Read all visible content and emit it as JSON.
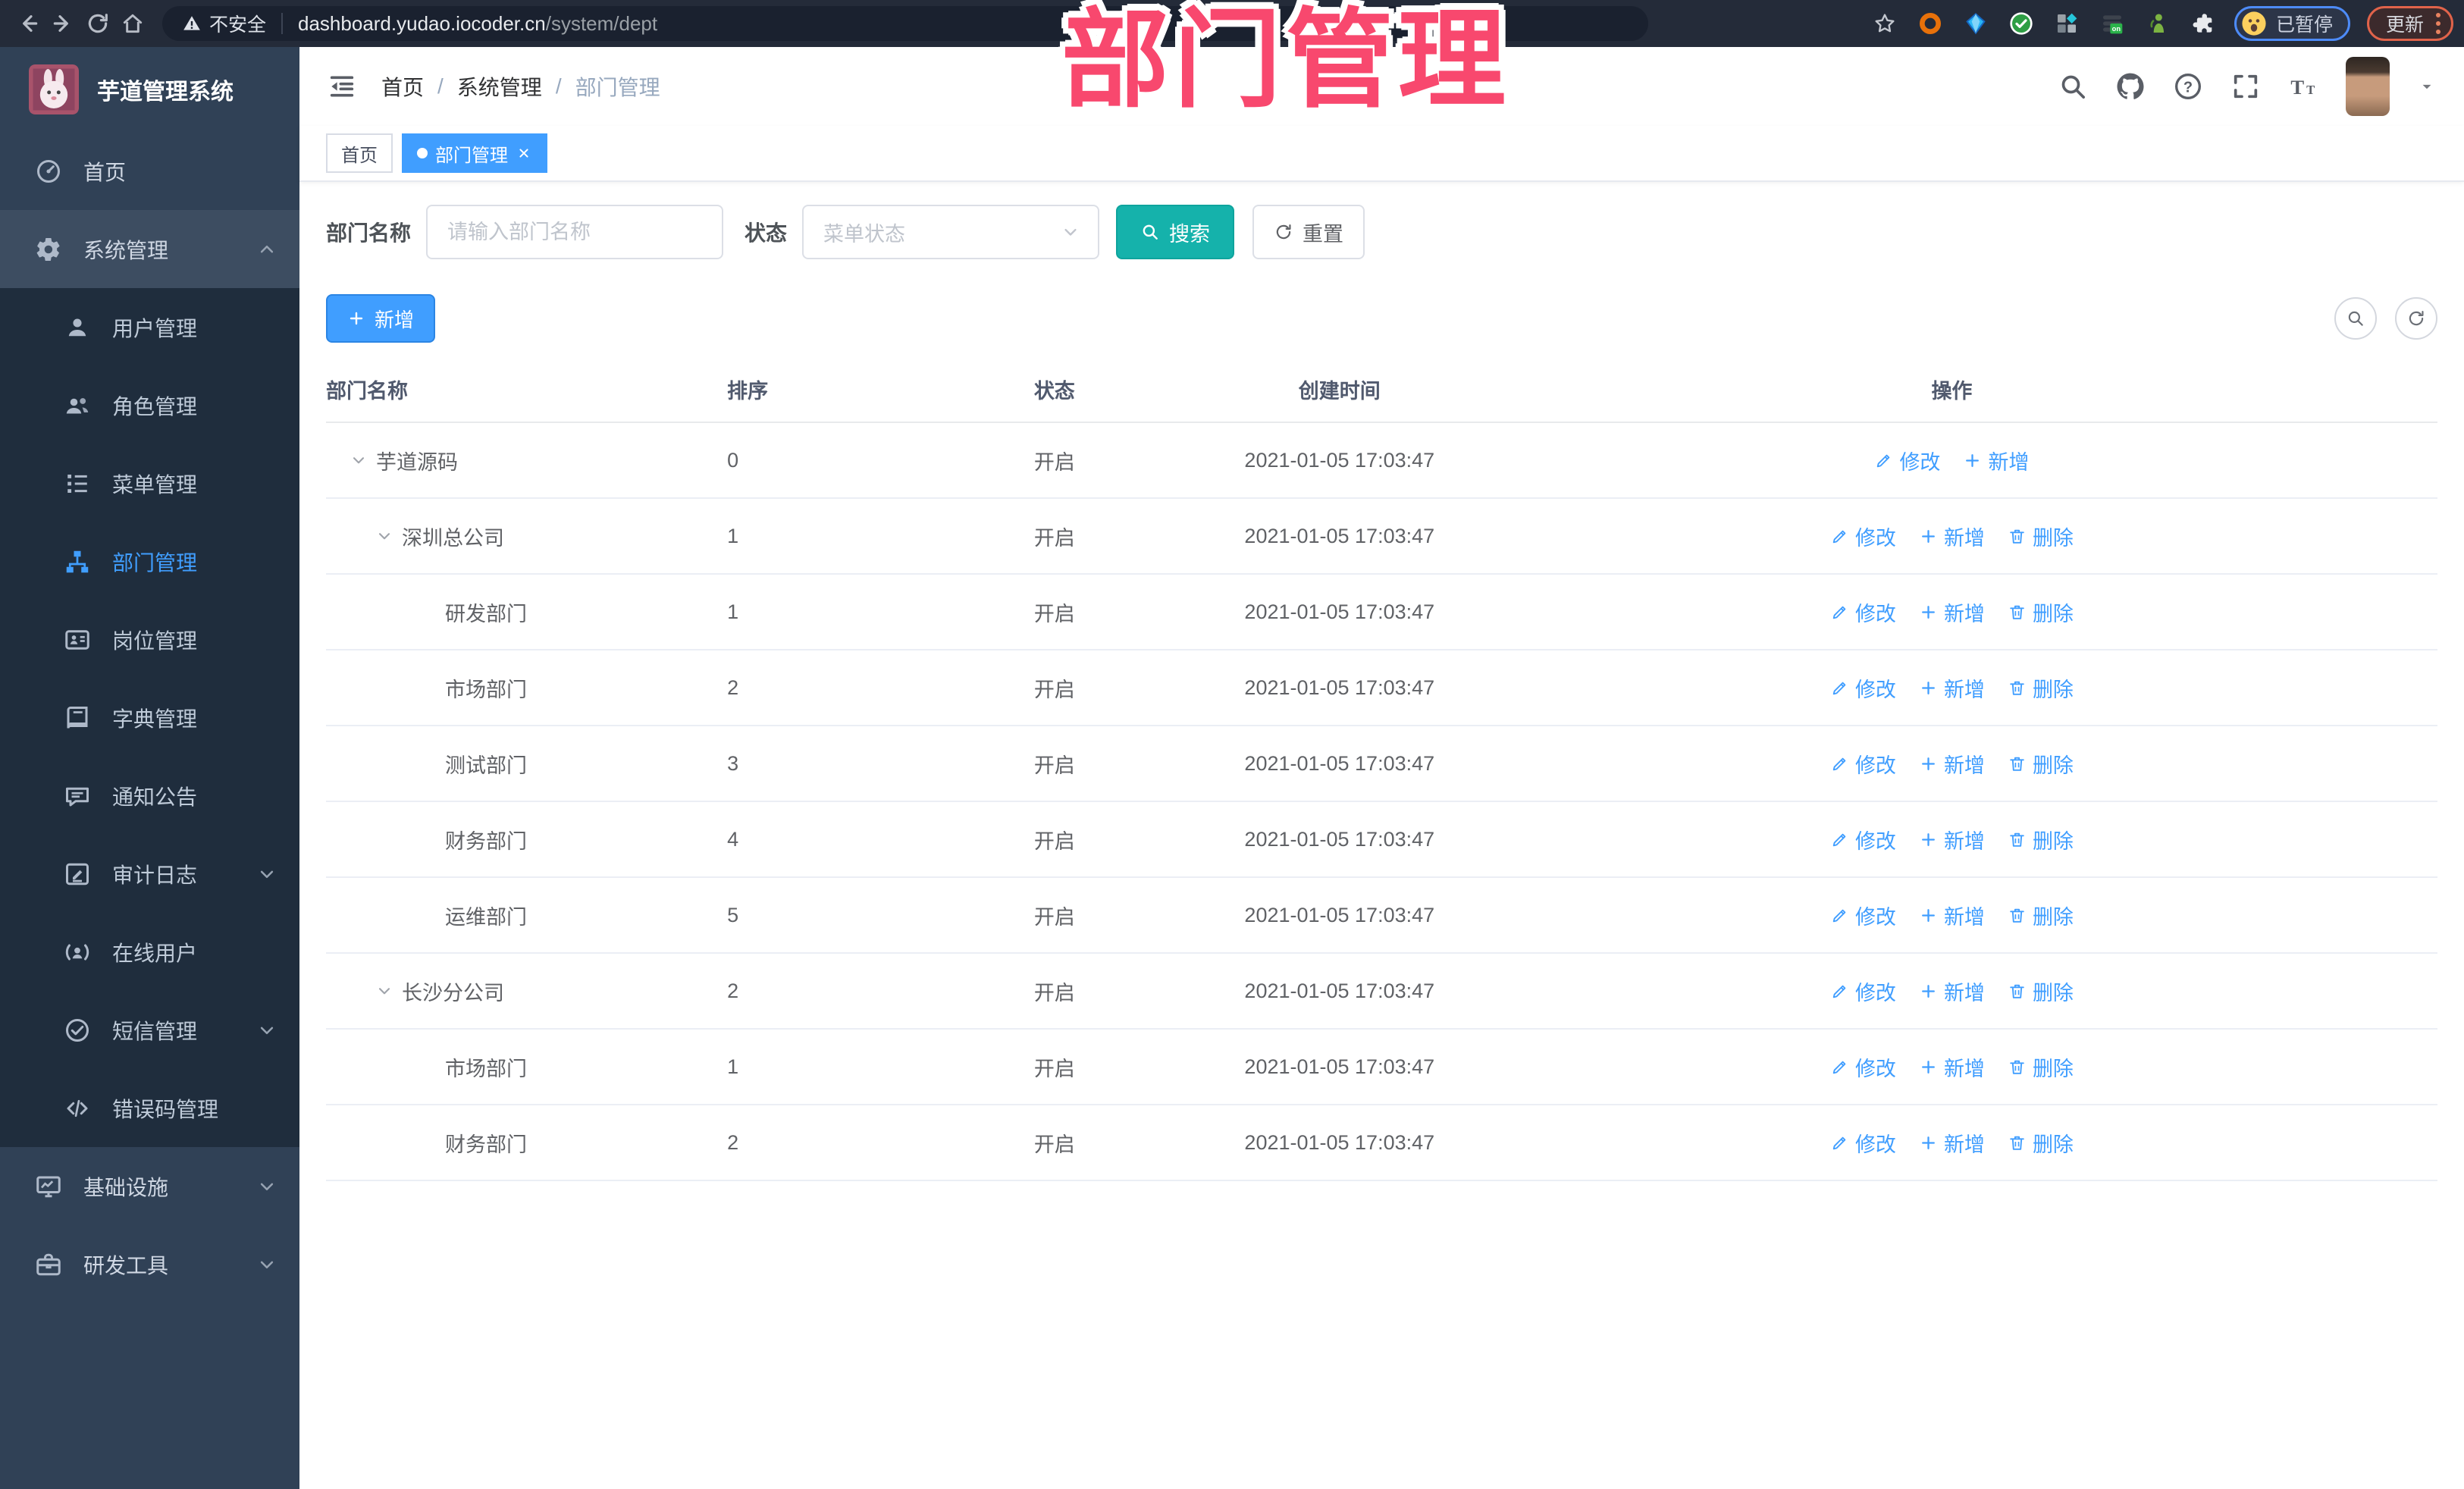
{
  "overlay": {
    "title": "部门管理"
  },
  "browser": {
    "security_label": "不安全",
    "url_host": "dashboard.yudao.iocoder.cn",
    "url_path": "/system/dept",
    "profile_status": "已暂停",
    "update_label": "更新"
  },
  "sidebar": {
    "app_title": "芋道管理系统",
    "items": [
      {
        "id": "home",
        "label": "首页",
        "icon": "dashboard-icon",
        "level": 0
      },
      {
        "id": "system-management",
        "label": "系统管理",
        "icon": "gear-icon",
        "level": 0,
        "chevron": "up",
        "highlight": true
      },
      {
        "id": "user-management",
        "label": "用户管理",
        "icon": "user-icon",
        "level": 1
      },
      {
        "id": "role-management",
        "label": "角色管理",
        "icon": "users-icon",
        "level": 1
      },
      {
        "id": "menu-management",
        "label": "菜单管理",
        "icon": "menu-list-icon",
        "level": 1
      },
      {
        "id": "dept-management",
        "label": "部门管理",
        "icon": "org-tree-icon",
        "level": 1,
        "active": true
      },
      {
        "id": "post-management",
        "label": "岗位管理",
        "icon": "id-card-icon",
        "level": 1
      },
      {
        "id": "dict-management",
        "label": "字典管理",
        "icon": "book-icon",
        "level": 1
      },
      {
        "id": "notice-announcement",
        "label": "通知公告",
        "icon": "megaphone-icon",
        "level": 1
      },
      {
        "id": "audit-log",
        "label": "审计日志",
        "icon": "log-icon",
        "level": 1,
        "chevron": "down"
      },
      {
        "id": "online-users",
        "label": "在线用户",
        "icon": "online-user-icon",
        "level": 1
      },
      {
        "id": "sms-management",
        "label": "短信管理",
        "icon": "sms-icon",
        "level": 1,
        "chevron": "down"
      },
      {
        "id": "error-code-management",
        "label": "错误码管理",
        "icon": "code-icon",
        "level": 1
      },
      {
        "id": "infrastructure",
        "label": "基础设施",
        "icon": "monitor-icon",
        "level": 0,
        "chevron": "down"
      },
      {
        "id": "dev-tools",
        "label": "研发工具",
        "icon": "toolbox-icon",
        "level": 0,
        "chevron": "down"
      }
    ]
  },
  "header": {
    "breadcrumb": [
      "首页",
      "系统管理",
      "部门管理"
    ]
  },
  "tags": [
    {
      "label": "首页",
      "active": false,
      "closable": false
    },
    {
      "label": "部门管理",
      "active": true,
      "closable": true
    }
  ],
  "filters": {
    "name_label": "部门名称",
    "name_placeholder": "请输入部门名称",
    "status_label": "状态",
    "status_placeholder": "菜单状态",
    "search_label": "搜索",
    "reset_label": "重置"
  },
  "toolbar": {
    "add_label": "新增"
  },
  "table": {
    "columns": [
      "部门名称",
      "排序",
      "状态",
      "创建时间",
      "操作"
    ],
    "action_labels": {
      "edit": "修改",
      "add": "新增",
      "delete": "删除"
    },
    "rows": [
      {
        "name": "芋道源码",
        "level": 0,
        "expandable": true,
        "sort": "0",
        "status": "开启",
        "created": "2021-01-05 17:03:47",
        "actions": [
          "edit",
          "add"
        ]
      },
      {
        "name": "深圳总公司",
        "level": 1,
        "expandable": true,
        "sort": "1",
        "status": "开启",
        "created": "2021-01-05 17:03:47",
        "actions": [
          "edit",
          "add",
          "delete"
        ]
      },
      {
        "name": "研发部门",
        "level": 2,
        "expandable": false,
        "sort": "1",
        "status": "开启",
        "created": "2021-01-05 17:03:47",
        "actions": [
          "edit",
          "add",
          "delete"
        ]
      },
      {
        "name": "市场部门",
        "level": 2,
        "expandable": false,
        "sort": "2",
        "status": "开启",
        "created": "2021-01-05 17:03:47",
        "actions": [
          "edit",
          "add",
          "delete"
        ]
      },
      {
        "name": "测试部门",
        "level": 2,
        "expandable": false,
        "sort": "3",
        "status": "开启",
        "created": "2021-01-05 17:03:47",
        "actions": [
          "edit",
          "add",
          "delete"
        ]
      },
      {
        "name": "财务部门",
        "level": 2,
        "expandable": false,
        "sort": "4",
        "status": "开启",
        "created": "2021-01-05 17:03:47",
        "actions": [
          "edit",
          "add",
          "delete"
        ]
      },
      {
        "name": "运维部门",
        "level": 2,
        "expandable": false,
        "sort": "5",
        "status": "开启",
        "created": "2021-01-05 17:03:47",
        "actions": [
          "edit",
          "add",
          "delete"
        ]
      },
      {
        "name": "长沙分公司",
        "level": 1,
        "expandable": true,
        "sort": "2",
        "status": "开启",
        "created": "2021-01-05 17:03:47",
        "actions": [
          "edit",
          "add",
          "delete"
        ]
      },
      {
        "name": "市场部门",
        "level": 2,
        "expandable": false,
        "sort": "1",
        "status": "开启",
        "created": "2021-01-05 17:03:47",
        "actions": [
          "edit",
          "add",
          "delete"
        ]
      },
      {
        "name": "财务部门",
        "level": 2,
        "expandable": false,
        "sort": "2",
        "status": "开启",
        "created": "2021-01-05 17:03:47",
        "actions": [
          "edit",
          "add",
          "delete"
        ]
      }
    ]
  }
}
